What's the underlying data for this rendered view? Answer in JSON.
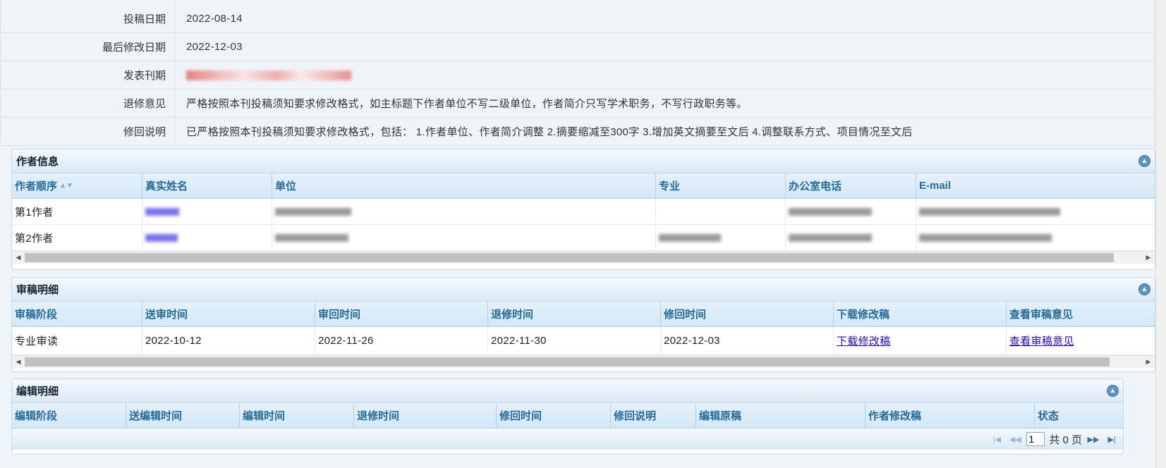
{
  "info_rows": [
    {
      "label": "投稿日期",
      "value": "2022-08-14"
    },
    {
      "label": "最后修改日期",
      "value": "2022-12-03"
    },
    {
      "label": "发表刊期",
      "value": ""
    },
    {
      "label": "退修意见",
      "value": "严格按照本刊投稿须知要求修改格式，如主标题下作者单位不写二级单位，作者简介只写学术职务，不写行政职务等。"
    },
    {
      "label": "修回说明",
      "value": "已严格按照本刊投稿须知要求修改格式，包括： 1.作者单位、作者简介调整 2.摘要缩减至300字 3.增加英文摘要至文后 4.调整联系方式、项目情况至文后"
    }
  ],
  "authors_panel": {
    "title": "作者信息",
    "columns": [
      "作者顺序",
      "真实姓名",
      "单位",
      "专业",
      "办公室电话",
      "E-mail"
    ],
    "rows": [
      {
        "order": "第1作者"
      },
      {
        "order": "第2作者"
      }
    ]
  },
  "review_panel": {
    "title": "审稿明细",
    "columns": [
      "审稿阶段",
      "送审时间",
      "审回时间",
      "退修时间",
      "修回时间",
      "下载修改稿",
      "查看审稿意见"
    ],
    "rows": [
      {
        "stage": "专业审读",
        "sent": "2022-10-12",
        "returned": "2022-11-26",
        "revision": "2022-11-30",
        "resubmitted": "2022-12-03",
        "download": "下载修改稿",
        "view": "查看审稿意见"
      }
    ]
  },
  "edit_panel": {
    "title": "编辑明细",
    "columns": [
      "编辑阶段",
      "送编辑时间",
      "编辑时间",
      "退修时间",
      "修回时间",
      "修回说明",
      "编辑原稿",
      "作者修改稿",
      "状态"
    ],
    "pager": {
      "page": "1",
      "total": "共 0 页"
    }
  },
  "icons": {
    "collapse": "collapse-up-icon",
    "sort": "sort-icon",
    "first": "first-page-icon",
    "prev": "prev-page-icon",
    "next": "next-page-icon",
    "last": "last-page-icon"
  }
}
